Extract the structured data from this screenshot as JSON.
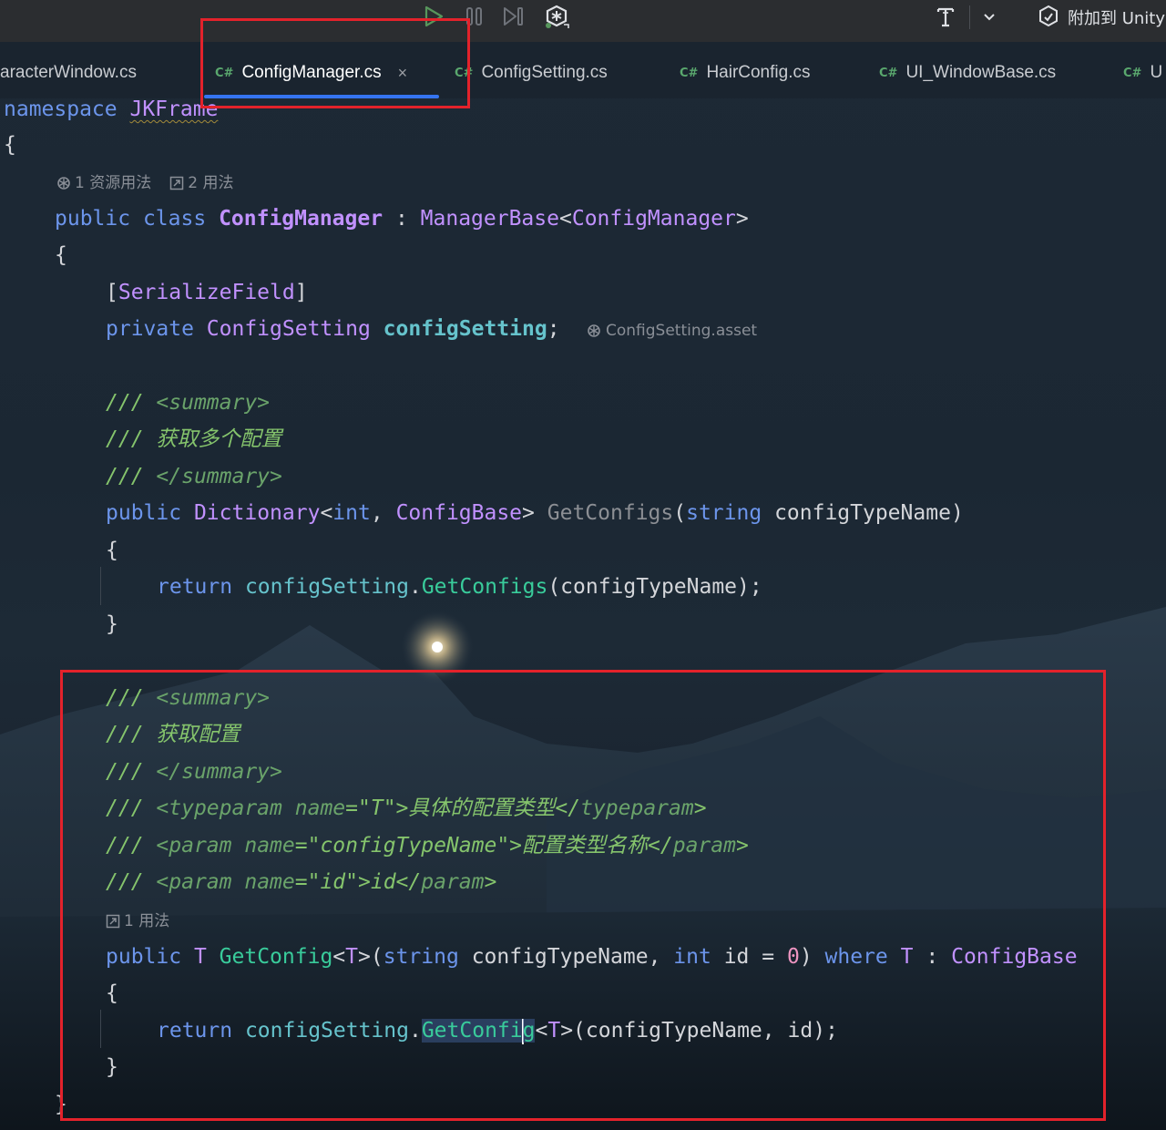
{
  "toolbar": {
    "attach_label": "附加到 Unity",
    "icons": [
      "run-icon",
      "debug-pause-icon",
      "step-over-icon",
      "unity-settings-icon",
      "font-icon",
      "chevron-down-icon",
      "attach-icon"
    ]
  },
  "tabs": [
    {
      "label": "aracterWindow.cs",
      "icon": "",
      "active": false
    },
    {
      "label": "ConfigManager.cs",
      "icon": "C#",
      "active": true,
      "close": "×"
    },
    {
      "label": "ConfigSetting.cs",
      "icon": "C#",
      "active": false
    },
    {
      "label": "HairConfig.cs",
      "icon": "C#",
      "active": false
    },
    {
      "label": "UI_WindowBase.cs",
      "icon": "C#",
      "active": false
    },
    {
      "label": "U",
      "icon": "C#",
      "active": false
    }
  ],
  "code": {
    "ns_kw": "namespace",
    "ns_name": "JKFrame",
    "brace_open": "{",
    "brace_close": "}",
    "class_hint_assets": "1 资源用法",
    "class_hint_usages": "2 用法",
    "kw_public": "public",
    "kw_class": "class",
    "class_name": "ConfigManager",
    "colon": ":",
    "base_type": "ManagerBase",
    "lt": "<",
    "gt": ">",
    "attr_open": "[",
    "attr_name": "SerializeField",
    "attr_close": "]",
    "kw_private": "private",
    "field_type": "ConfigSetting",
    "field_name": "configSetting",
    "semicolon": ";",
    "field_hint": "ConfigSetting.asset",
    "doc_prefix": "///",
    "summary_open": "<summary>",
    "summary_close": "</summary>",
    "doc1_text": "获取多个配置",
    "dict_type": "Dictionary",
    "kw_int": "int",
    "comma": ",",
    "config_base": "ConfigBase",
    "method1": "GetConfigs",
    "paren_open": "(",
    "paren_close": ")",
    "kw_string": "string",
    "param_name": "configTypeName",
    "kw_return": "return",
    "dot": ".",
    "doc2_text": "获取配置",
    "tp_open": "<typeparam",
    "attr_name_kw": "name",
    "eq": "=",
    "t_str": "\"T\"",
    "tp_text": ">具体的配置类型</",
    "tp_tag": "typeparam",
    "param_open": "<param",
    "cfg_str": "\"configTypeName\"",
    "param1_text": ">配置类型名称</",
    "param_tag": "param",
    "id_str": "\"id\"",
    "param2_text": ">id</",
    "method2_hint": "1 用法",
    "type_T": "T",
    "method2": "GetConfig",
    "param_id": "id",
    "zero": "0",
    "kw_where": "where",
    "method2_call_a": "GetConfi",
    "method2_call_b": "g"
  }
}
